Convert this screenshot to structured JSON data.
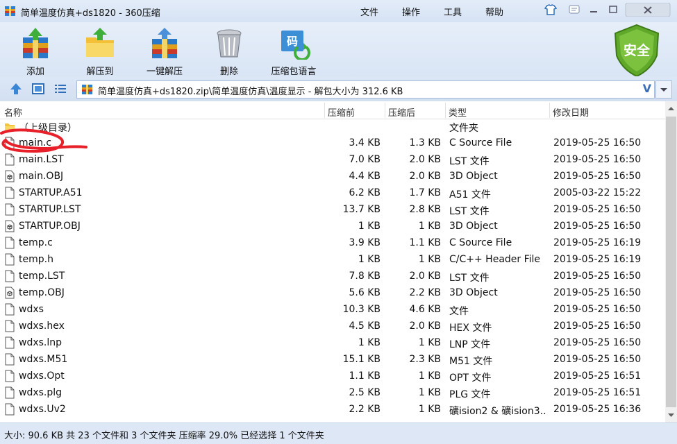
{
  "window": {
    "title": "简单温度仿真+ds1820 - 360压缩",
    "menu": [
      "文件",
      "操作",
      "工具",
      "帮助"
    ]
  },
  "toolbar": {
    "add_label": "添加",
    "extract_label": "解压到",
    "oneclick_label": "一键解压",
    "delete_label": "删除",
    "lang_label": "压缩包语言",
    "security_label": "安全"
  },
  "address": {
    "path": "简单温度仿真+ds1820.zip\\简单温度仿真\\温度显示 - 解包大小为 312.6 KB"
  },
  "columns": {
    "name": "名称",
    "size": "压缩前",
    "packed": "压缩后",
    "type": "类型",
    "modified": "修改日期"
  },
  "files": [
    {
      "name": "（上级目录）",
      "size": "",
      "packed": "",
      "type": "文件夹",
      "modified": "",
      "icon": "folder-icon"
    },
    {
      "name": "main.c",
      "size": "3.4 KB",
      "packed": "1.3 KB",
      "type": "C Source File",
      "modified": "2019-05-25 16:50",
      "icon": "file-icon"
    },
    {
      "name": "main.LST",
      "size": "7.0 KB",
      "packed": "2.0 KB",
      "type": "LST 文件",
      "modified": "2019-05-25 16:50",
      "icon": "file-icon"
    },
    {
      "name": "main.OBJ",
      "size": "4.4 KB",
      "packed": "2.0 KB",
      "type": "3D Object",
      "modified": "2019-05-25 16:50",
      "icon": "object-file-icon"
    },
    {
      "name": "STARTUP.A51",
      "size": "6.2 KB",
      "packed": "1.7 KB",
      "type": "A51 文件",
      "modified": "2005-03-22 15:22",
      "icon": "file-icon"
    },
    {
      "name": "STARTUP.LST",
      "size": "13.7 KB",
      "packed": "2.8 KB",
      "type": "LST 文件",
      "modified": "2019-05-25 16:50",
      "icon": "file-icon"
    },
    {
      "name": "STARTUP.OBJ",
      "size": "1 KB",
      "packed": "1 KB",
      "type": "3D Object",
      "modified": "2019-05-25 16:50",
      "icon": "object-file-icon"
    },
    {
      "name": "temp.c",
      "size": "3.9 KB",
      "packed": "1.1 KB",
      "type": "C Source File",
      "modified": "2019-05-25 16:19",
      "icon": "file-icon"
    },
    {
      "name": "temp.h",
      "size": "1 KB",
      "packed": "1 KB",
      "type": "C/C++ Header File",
      "modified": "2019-05-25 16:19",
      "icon": "file-icon"
    },
    {
      "name": "temp.LST",
      "size": "7.8 KB",
      "packed": "2.0 KB",
      "type": "LST 文件",
      "modified": "2019-05-25 16:50",
      "icon": "file-icon"
    },
    {
      "name": "temp.OBJ",
      "size": "5.6 KB",
      "packed": "2.2 KB",
      "type": "3D Object",
      "modified": "2019-05-25 16:50",
      "icon": "object-file-icon"
    },
    {
      "name": "wdxs",
      "size": "10.3 KB",
      "packed": "4.6 KB",
      "type": "文件",
      "modified": "2019-05-25 16:50",
      "icon": "file-icon"
    },
    {
      "name": "wdxs.hex",
      "size": "4.5 KB",
      "packed": "2.0 KB",
      "type": "HEX 文件",
      "modified": "2019-05-25 16:50",
      "icon": "file-icon"
    },
    {
      "name": "wdxs.lnp",
      "size": "1 KB",
      "packed": "1 KB",
      "type": "LNP 文件",
      "modified": "2019-05-25 16:50",
      "icon": "file-icon"
    },
    {
      "name": "wdxs.M51",
      "size": "15.1 KB",
      "packed": "2.3 KB",
      "type": "M51 文件",
      "modified": "2019-05-25 16:50",
      "icon": "file-icon"
    },
    {
      "name": "wdxs.Opt",
      "size": "1.1 KB",
      "packed": "1 KB",
      "type": "OPT 文件",
      "modified": "2019-05-25 16:51",
      "icon": "file-icon"
    },
    {
      "name": "wdxs.plg",
      "size": "2.5 KB",
      "packed": "1 KB",
      "type": "PLG 文件",
      "modified": "2019-05-25 16:51",
      "icon": "file-icon"
    },
    {
      "name": "wdxs.Uv2",
      "size": "2.2 KB",
      "packed": "1 KB",
      "type": "礦ision2 & 礦ision3...",
      "modified": "2019-05-25 16:36",
      "icon": "file-icon"
    }
  ],
  "status": {
    "text": "大小: 90.6 KB 共 23 个文件和 3 个文件夹 压缩率 29.0% 已经选择 1 个文件夹"
  },
  "colors": {
    "accent": "#3a6fb8",
    "annotation": "#e8202a",
    "shield": "#5fa82a"
  }
}
